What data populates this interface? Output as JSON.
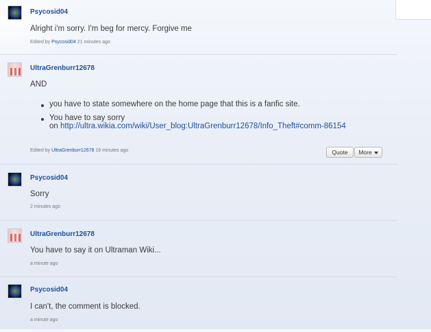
{
  "posts": [
    {
      "username": "Psycosid04",
      "text": "Alright i'm sorry. I'm beg for mercy. Forgive me",
      "meta_prefix": "Edited by",
      "meta_user": "Psycosid04",
      "meta_time": "21 minutes ago",
      "avatar": "earth-avatar"
    },
    {
      "username": "UltraGrenburr12678",
      "text": "AND",
      "bullets": [
        "you have to state somewhere on the home page that this is a fanfic site.",
        "You have to say sorry"
      ],
      "bullet_cont_prefix": "on",
      "link": "http://ultra.wikia.com/wiki/User_blog:UltraGrenburr12678/Info_Theft#comm-86154",
      "meta_prefix": "Edited by",
      "meta_user": "UltraGrenburr12678",
      "meta_time": "16 minutes ago",
      "quote_label": "Quote",
      "more_label": "More",
      "avatar": "hero-avatar"
    },
    {
      "username": "Psycosid04",
      "text": "Sorry",
      "meta_time": "2 minutes ago",
      "avatar": "earth-avatar"
    },
    {
      "username": "UltraGrenburr12678",
      "text": "You have to say it on Ultraman Wiki...",
      "meta_time": "a minute ago",
      "avatar": "hero-avatar"
    },
    {
      "username": "Psycosid04",
      "text": "I can't, the comment is blocked.",
      "meta_time": "a minute ago",
      "avatar": "earth-avatar"
    }
  ]
}
